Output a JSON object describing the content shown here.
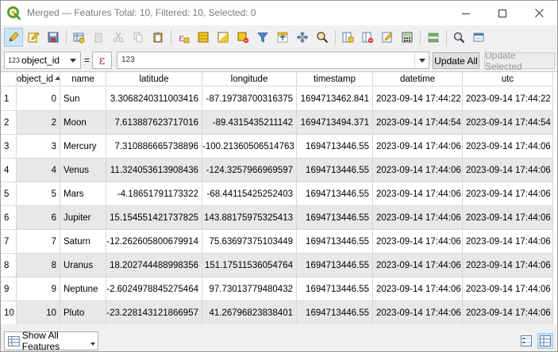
{
  "window": {
    "title": "Merged — Features Total: 10, Filtered: 10, Selected: 0"
  },
  "toolbar": {
    "buttons": [
      "toggle-editing-icon",
      "multi-edit-icon",
      "save-edits-icon",
      "reload-icon",
      "add-feature-icon",
      "delete-feature-icon",
      "cut-icon",
      "copy-icon",
      "paste-icon",
      "select-by-expression-icon",
      "select-all-icon",
      "invert-selection-icon",
      "deselect-all-icon",
      "filter-selection-icon",
      "move-selection-top-icon",
      "pan-to-selection-icon",
      "zoom-to-selection-icon",
      "new-field-icon",
      "delete-field-icon",
      "field-calculator-icon",
      "conditional-formatting-icon",
      "actions-icon",
      "dock-icon",
      "organize-columns-icon"
    ]
  },
  "filter": {
    "field_type_badge": "123",
    "field_name": "object_id",
    "equals": "=",
    "expression_symbol": "ε",
    "value_placeholder": "123",
    "update_all_label": "Update All",
    "update_selected_label": "Update Selected"
  },
  "table": {
    "columns": [
      "object_id",
      "name",
      "latitude",
      "longitude",
      "timestamp",
      "datetime",
      "utc"
    ],
    "sorted_column": "object_id",
    "rows": [
      {
        "row": "1",
        "object_id": "0",
        "name": "Sun",
        "latitude": "3.3068240311003416",
        "longitude": "-87.19738700316375",
        "timestamp": "1694713462.841",
        "datetime": "2023-09-14 17:44:22",
        "utc": "2023-09-14 17:44:22"
      },
      {
        "row": "2",
        "object_id": "2",
        "name": "Moon",
        "latitude": "7.613887623717016",
        "longitude": "-89.4315435211142",
        "timestamp": "1694713494.371",
        "datetime": "2023-09-14 17:44:54",
        "utc": "2023-09-14 17:44:54"
      },
      {
        "row": "3",
        "object_id": "3",
        "name": "Mercury",
        "latitude": "7.310886665738896",
        "longitude": "-100.21360506514763",
        "timestamp": "1694713446.55",
        "datetime": "2023-09-14 17:44:06",
        "utc": "2023-09-14 17:44:06"
      },
      {
        "row": "4",
        "object_id": "4",
        "name": "Venus",
        "latitude": "11.324053613908436",
        "longitude": "-124.3257966969597",
        "timestamp": "1694713446.55",
        "datetime": "2023-09-14 17:44:06",
        "utc": "2023-09-14 17:44:06"
      },
      {
        "row": "5",
        "object_id": "5",
        "name": "Mars",
        "latitude": "-4.18651791173322",
        "longitude": "-68.44115425252403",
        "timestamp": "1694713446.55",
        "datetime": "2023-09-14 17:44:06",
        "utc": "2023-09-14 17:44:06"
      },
      {
        "row": "6",
        "object_id": "6",
        "name": "Jupiter",
        "latitude": "15.154551421737825",
        "longitude": "143.88175975325413",
        "timestamp": "1694713446.55",
        "datetime": "2023-09-14 17:44:06",
        "utc": "2023-09-14 17:44:06"
      },
      {
        "row": "7",
        "object_id": "7",
        "name": "Saturn",
        "latitude": "-12.262605800679914",
        "longitude": "75.63697375103449",
        "timestamp": "1694713446.55",
        "datetime": "2023-09-14 17:44:06",
        "utc": "2023-09-14 17:44:06"
      },
      {
        "row": "8",
        "object_id": "8",
        "name": "Uranus",
        "latitude": "18.202744488998356",
        "longitude": "151.17511536054764",
        "timestamp": "1694713446.55",
        "datetime": "2023-09-14 17:44:06",
        "utc": "2023-09-14 17:44:06"
      },
      {
        "row": "9",
        "object_id": "9",
        "name": "Neptune",
        "latitude": "-2.6024978845275464",
        "longitude": "97.73013779480432",
        "timestamp": "1694713446.55",
        "datetime": "2023-09-14 17:44:06",
        "utc": "2023-09-14 17:44:06"
      },
      {
        "row": "10",
        "object_id": "10",
        "name": "Pluto",
        "latitude": "-23.228143121866957",
        "longitude": "41.26796823838401",
        "timestamp": "1694713446.55",
        "datetime": "2023-09-14 17:44:06",
        "utc": "2023-09-14 17:44:06"
      }
    ]
  },
  "bottom": {
    "show_features_label": "Show All Features",
    "view_modes": [
      "form-view-icon",
      "table-view-icon"
    ]
  },
  "colors": {
    "qgis_green": "#5aa02c",
    "qgis_yellow": "#f0c419",
    "selection_blue": "#cde4f7",
    "alt_row": "#e8e8e8"
  }
}
